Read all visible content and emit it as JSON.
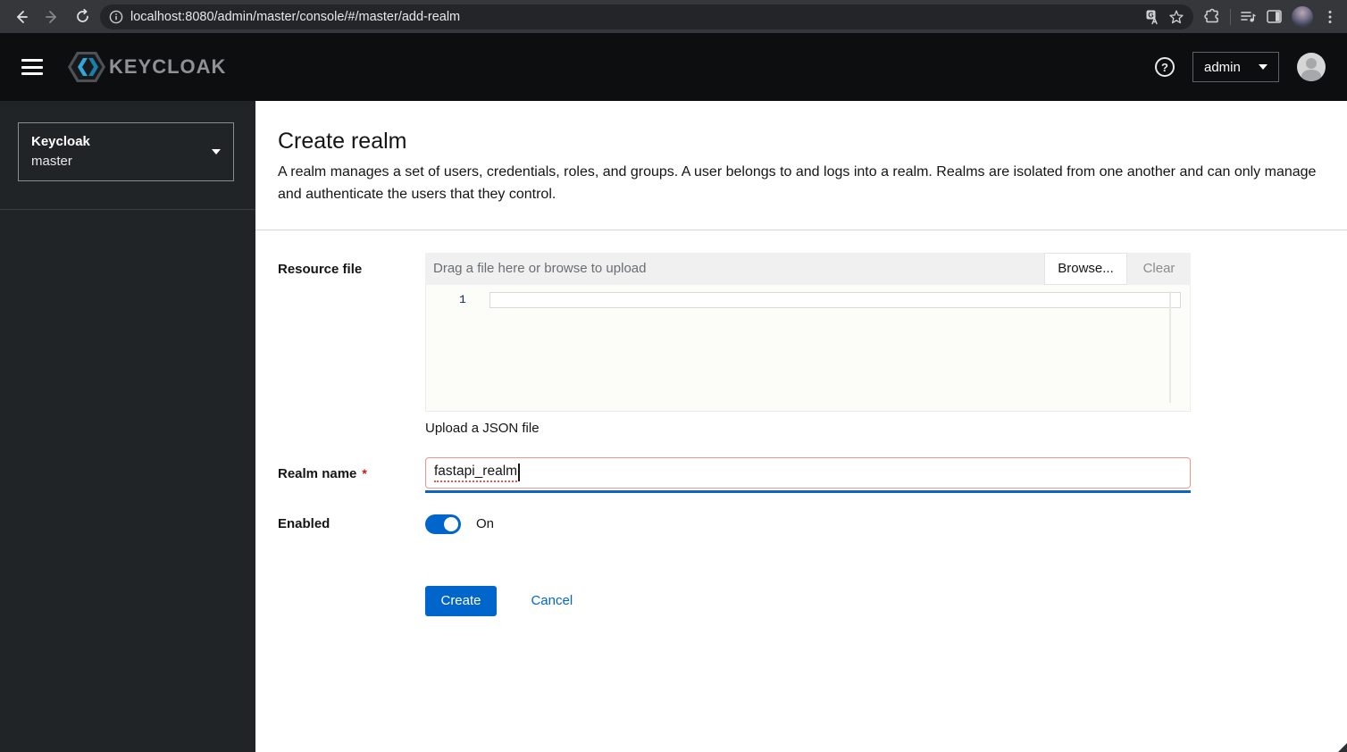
{
  "browser": {
    "url": "localhost:8080/admin/master/console/#/master/add-realm"
  },
  "masthead": {
    "brand": "KEYCLOAK",
    "user": "admin"
  },
  "sidebar": {
    "realm_title": "Keycloak",
    "realm_current": "master"
  },
  "page": {
    "title": "Create realm",
    "description": "A realm manages a set of users, credentials, roles, and groups. A user belongs to and logs into a realm. Realms are isolated from one another and can only manage and authenticate the users that they control."
  },
  "form": {
    "resource_file": {
      "label": "Resource file",
      "placeholder": "Drag a file here or browse to upload",
      "browse": "Browse...",
      "clear": "Clear",
      "line_number": "1",
      "helper": "Upload a JSON file"
    },
    "realm_name": {
      "label": "Realm name",
      "required": "*",
      "value": "fastapi_realm"
    },
    "enabled": {
      "label": "Enabled",
      "state": "On"
    },
    "actions": {
      "create": "Create",
      "cancel": "Cancel"
    }
  },
  "colors": {
    "accent_blue": "#0066cc",
    "error_red": "#c9190b",
    "error_border": "#ee968d",
    "masthead_bg": "#0d0e10",
    "sidebar_bg": "#212427"
  }
}
